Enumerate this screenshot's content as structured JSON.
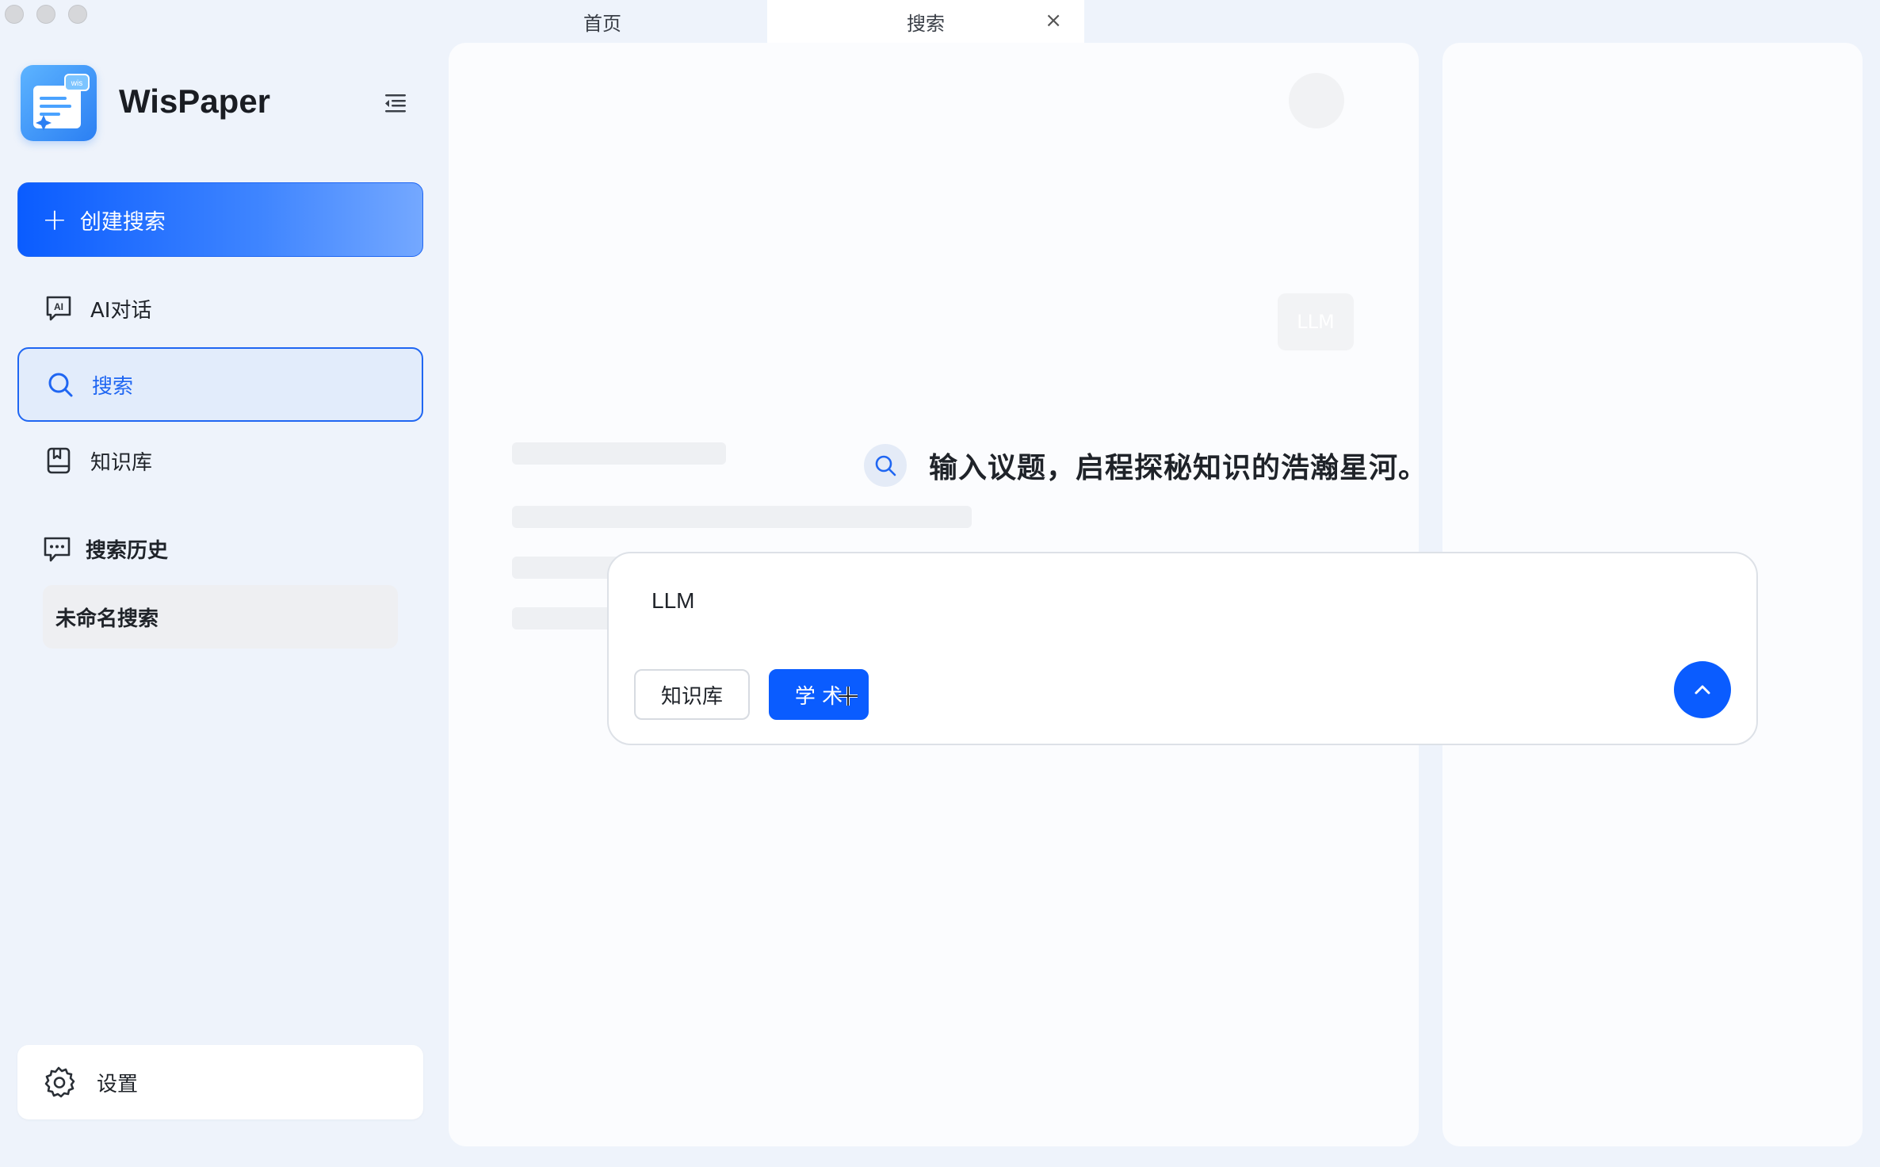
{
  "window": {
    "tabs": [
      {
        "label": "首页"
      },
      {
        "label": "搜索"
      }
    ],
    "close_glyph": "×"
  },
  "sidebar": {
    "brand": "WisPaper",
    "logo_badge": "wis",
    "create_label": "创建搜索",
    "nav": [
      {
        "label": "AI对话",
        "icon": "ai-chat-icon"
      },
      {
        "label": "搜索",
        "icon": "search-icon",
        "active": true
      },
      {
        "label": "知识库",
        "icon": "knowledge-base-icon"
      }
    ],
    "history_title": "搜索历史",
    "history_items": [
      {
        "label": "未命名搜索"
      }
    ],
    "settings_label": "设置"
  },
  "main": {
    "hero_text": "输入议题，启程探秘知识的浩瀚星河。",
    "query_value": "LLM",
    "chips": [
      {
        "label": "知识库",
        "selected": false
      },
      {
        "label": "学 术",
        "selected": true
      }
    ],
    "ghost_chip_label": "LLM"
  },
  "colors": {
    "accent": "#0a5cff",
    "background": "#eef3fb",
    "panel": "#fbfcfe"
  }
}
